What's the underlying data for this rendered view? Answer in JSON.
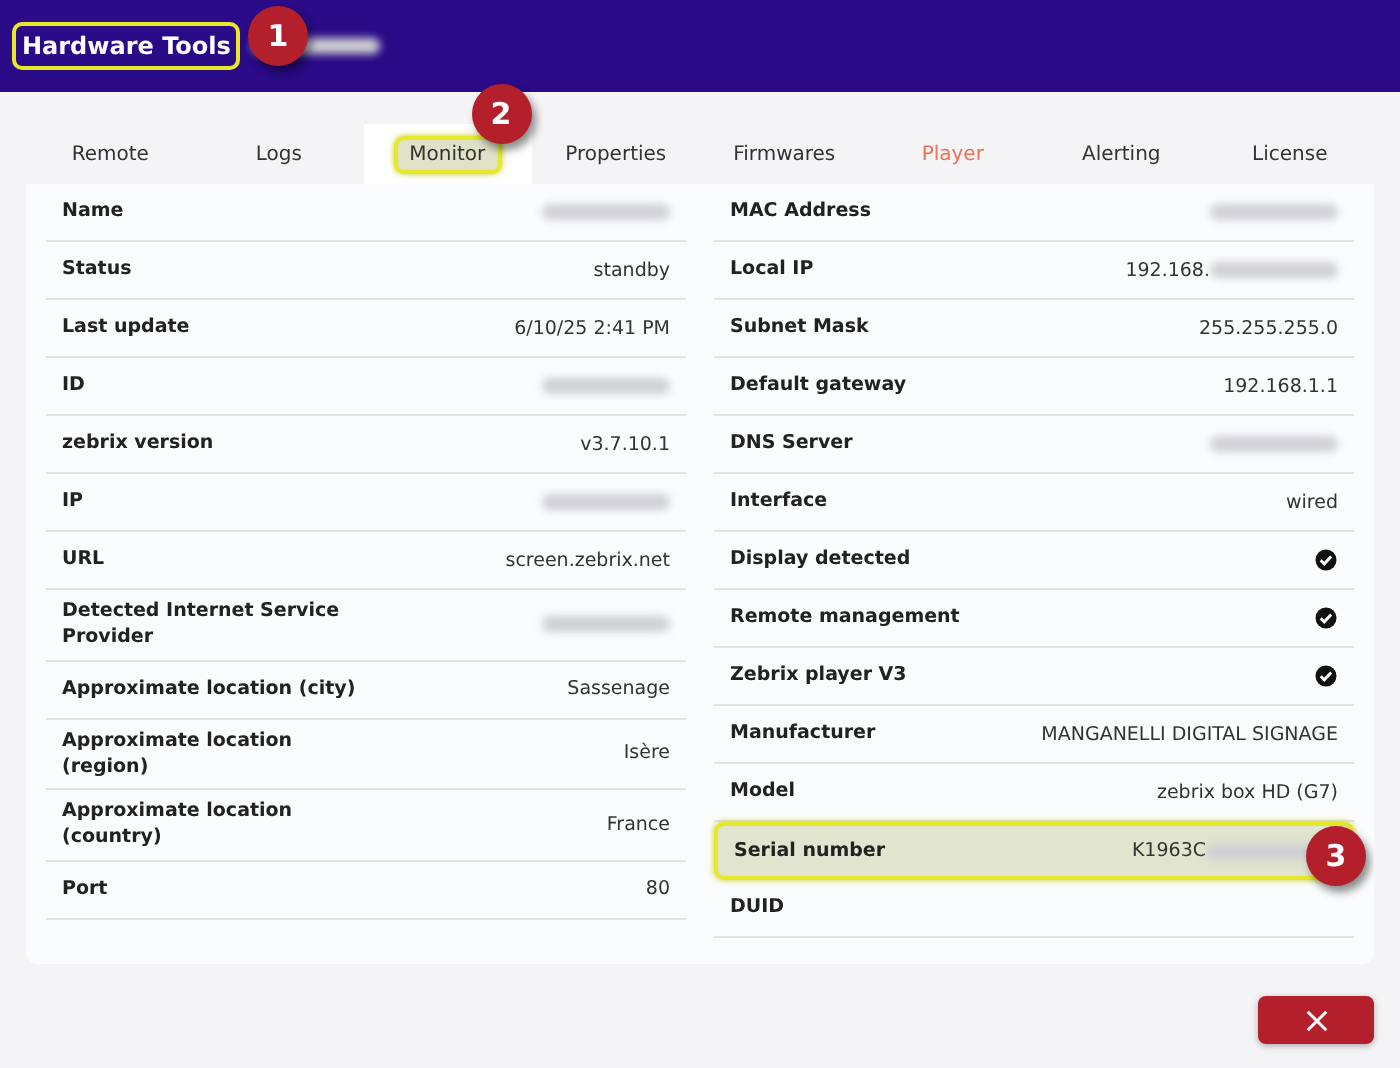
{
  "header": {
    "title": "Hardware Tools",
    "title_highlighted": true,
    "subtitle_redacted": true,
    "callout": "1"
  },
  "tabs": [
    {
      "label": "Remote",
      "selected": false,
      "color": "#333333"
    },
    {
      "label": "Logs",
      "selected": false,
      "color": "#333333"
    },
    {
      "label": "Monitor",
      "selected": true,
      "color": "#333333",
      "highlighted": true,
      "callout": "2"
    },
    {
      "label": "Properties",
      "selected": false,
      "color": "#333333"
    },
    {
      "label": "Firmwares",
      "selected": false,
      "color": "#333333"
    },
    {
      "label": "Player",
      "selected": false,
      "color": "#e8735a"
    },
    {
      "label": "Alerting",
      "selected": false,
      "color": "#333333"
    },
    {
      "label": "License",
      "selected": false,
      "color": "#333333"
    }
  ],
  "left_rows": [
    {
      "label": "Name",
      "redacted": true
    },
    {
      "label": "Status",
      "value": "standby"
    },
    {
      "label": "Last update",
      "value": "6/10/25 2:41 PM"
    },
    {
      "label": "ID",
      "redacted": true
    },
    {
      "label": "zebrix version",
      "value": "v3.7.10.1"
    },
    {
      "label": "IP",
      "redacted": true
    },
    {
      "label": "URL",
      "value": "screen.zebrix.net"
    },
    {
      "label": "Detected Internet Service Provider",
      "redacted": true
    },
    {
      "label": "Approximate location (city)",
      "value": "Sassenage"
    },
    {
      "label": "Approximate location (region)",
      "value": "Isère"
    },
    {
      "label": "Approximate location (country)",
      "value": "France"
    },
    {
      "label": "Port",
      "value": "80"
    }
  ],
  "right_rows": [
    {
      "label": "MAC Address",
      "redacted": true
    },
    {
      "label": "Local IP",
      "value": "192.168.",
      "redacted": true
    },
    {
      "label": "Subnet Mask",
      "value": "255.255.255.0"
    },
    {
      "label": "Default gateway",
      "value": "192.168.1.1"
    },
    {
      "label": "DNS Server",
      "redacted": true
    },
    {
      "label": "Interface",
      "value": "wired"
    },
    {
      "label": "Display detected",
      "checked": true
    },
    {
      "label": "Remote management",
      "checked": true
    },
    {
      "label": "Zebrix player V3",
      "checked": true
    },
    {
      "label": "Manufacturer",
      "value": "MANGANELLI DIGITAL SIGNAGE"
    },
    {
      "label": "Model",
      "value": "zebrix box HD (G7)"
    },
    {
      "label": "Serial number",
      "value": "K1963C",
      "redacted": true,
      "highlighted": true,
      "callout": "3"
    },
    {
      "label": "DUID"
    }
  ]
}
